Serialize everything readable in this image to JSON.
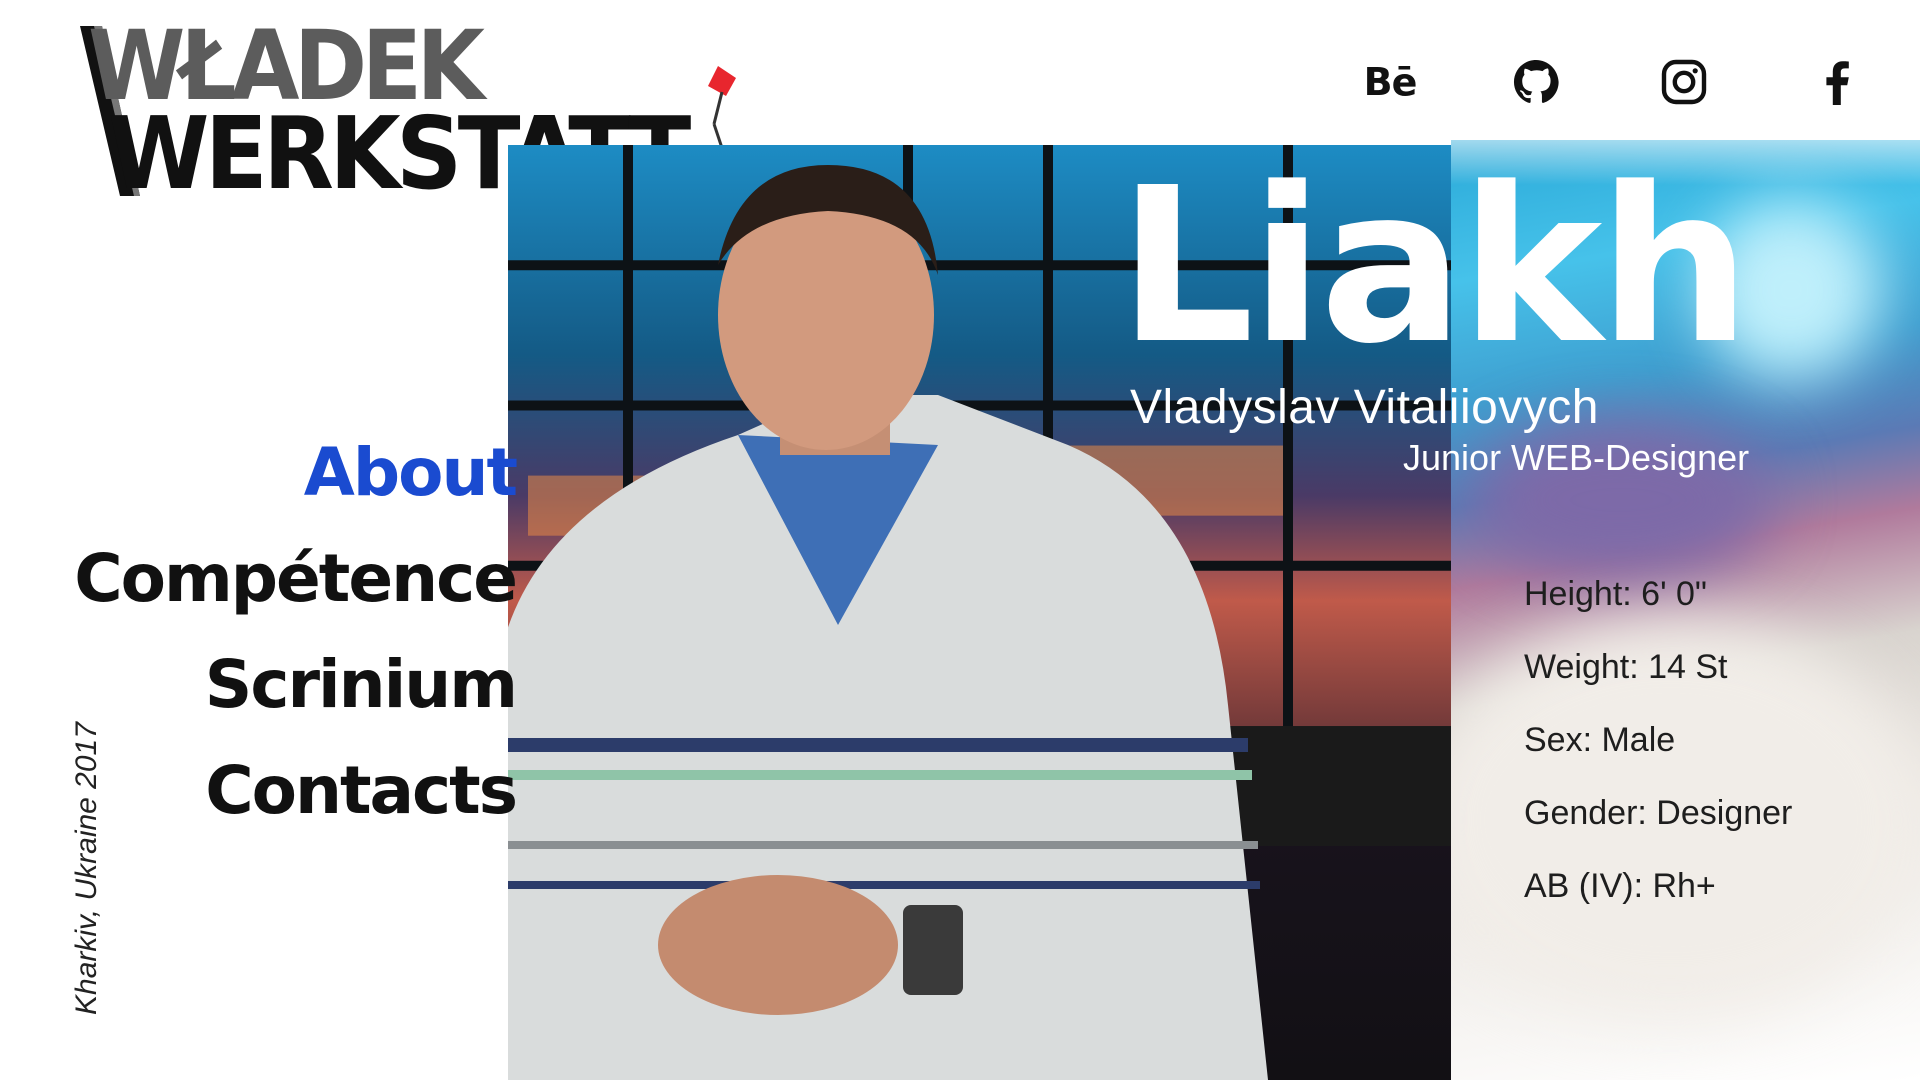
{
  "logo": {
    "line1": "WŁADEK",
    "line2": "WERKSTATT"
  },
  "social": [
    {
      "name": "Behance",
      "label": "Bē",
      "icon": "behance-icon"
    },
    {
      "name": "GitHub",
      "icon": "github-icon"
    },
    {
      "name": "Instagram",
      "icon": "instagram-icon"
    },
    {
      "name": "Facebook",
      "icon": "facebook-icon"
    }
  ],
  "nav": {
    "items": [
      {
        "label": "About",
        "active": true
      },
      {
        "label": "Compétence",
        "active": false
      },
      {
        "label": "Scrinium",
        "active": false
      },
      {
        "label": "Contacts",
        "active": false
      }
    ]
  },
  "hero": {
    "surname": "Liakh",
    "fullname": "Vladyslav Vitaliiovych",
    "role": "Junior WEB-Designer"
  },
  "stats": [
    "Height: 6' 0\"",
    "Weight: 14 St",
    "Sex: Male",
    "Gender: Designer",
    "AB (IV): Rh+"
  ],
  "location": "Kharkiv, Ukraine 2017",
  "colors": {
    "accent": "#1a4bd0",
    "text": "#111111",
    "logo_grey": "#5c5c5c",
    "lamp_red": "#e8262e"
  }
}
